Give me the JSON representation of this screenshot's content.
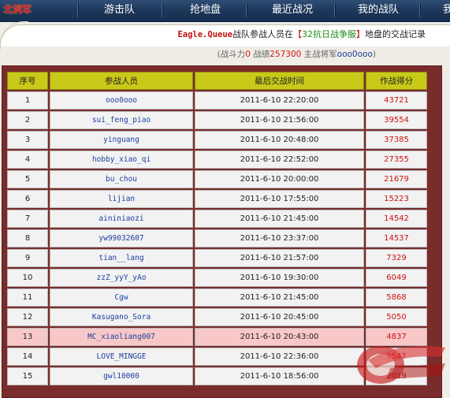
{
  "nav": {
    "logo": "北洞军",
    "items": [
      "游击队",
      "抢地盘",
      "最近战况",
      "我的战队",
      "我"
    ]
  },
  "header": {
    "team_name": "Eagle.Queue",
    "title_mid": "战队参战人员在",
    "bracket_open": "【",
    "server": "32抗日战争服",
    "bracket_close": "】",
    "title_end": "地盘的交战记录",
    "sub_open": "(战斗力",
    "power": "0",
    "sub_score_label": " 战绩",
    "score": "257300",
    "sub_gen_label": " 主战将军",
    "general": "ooo0ooo",
    "sub_close": ")"
  },
  "table": {
    "headers": [
      "序号",
      "参战人员",
      "最后交战时间",
      "作战得分"
    ],
    "rows": [
      {
        "no": "1",
        "name": "ooo0ooo",
        "time": "2011-6-10 22:20:00",
        "score": "43721"
      },
      {
        "no": "2",
        "name": "sui_feng_piao",
        "time": "2011-6-10 21:56:00",
        "score": "39554"
      },
      {
        "no": "3",
        "name": "yinguang",
        "time": "2011-6-10 20:48:00",
        "score": "37385"
      },
      {
        "no": "4",
        "name": "hobby_xiao_qi",
        "time": "2011-6-10 22:52:00",
        "score": "27355"
      },
      {
        "no": "5",
        "name": "bu_chou",
        "time": "2011-6-10 20:00:00",
        "score": "21679"
      },
      {
        "no": "6",
        "name": "lijian",
        "time": "2011-6-10 17:55:00",
        "score": "15223"
      },
      {
        "no": "7",
        "name": "aininiaozi",
        "time": "2011-6-10 21:45:00",
        "score": "14542"
      },
      {
        "no": "8",
        "name": "yw99032607",
        "time": "2011-6-10 23:37:00",
        "score": "14537"
      },
      {
        "no": "9",
        "name": "tian__lang",
        "time": "2011-6-10 21:57:00",
        "score": "7329"
      },
      {
        "no": "10",
        "name": "zzZ_yyY_yAo",
        "time": "2011-6-10 19:30:00",
        "score": "6049"
      },
      {
        "no": "11",
        "name": "Cgw",
        "time": "2011-6-10 21:45:00",
        "score": "5868"
      },
      {
        "no": "12",
        "name": "Kasugano_Sora",
        "time": "2011-6-10 20:45:00",
        "score": "5050"
      },
      {
        "no": "13",
        "name": "MC_xiaoliang007",
        "time": "2011-6-10 20:43:00",
        "score": "4837",
        "highlight": true
      },
      {
        "no": "14",
        "name": "LOVE_MINGGE",
        "time": "2011-6-10 22:36:00",
        "score": "2547"
      },
      {
        "no": "15",
        "name": "gwl10000",
        "time": "2011-6-10 18:56:00",
        "score": "2019"
      }
    ]
  },
  "colors": {
    "nav_bg": "#1c3558",
    "frame": "#7a2c2c",
    "header_cell": "#c9c91a",
    "highlight_row": "#f8c8c8",
    "score": "#cc1111",
    "name_link": "#1c3fa0"
  },
  "icons": {
    "watermark": "game-site-watermark-logo"
  }
}
